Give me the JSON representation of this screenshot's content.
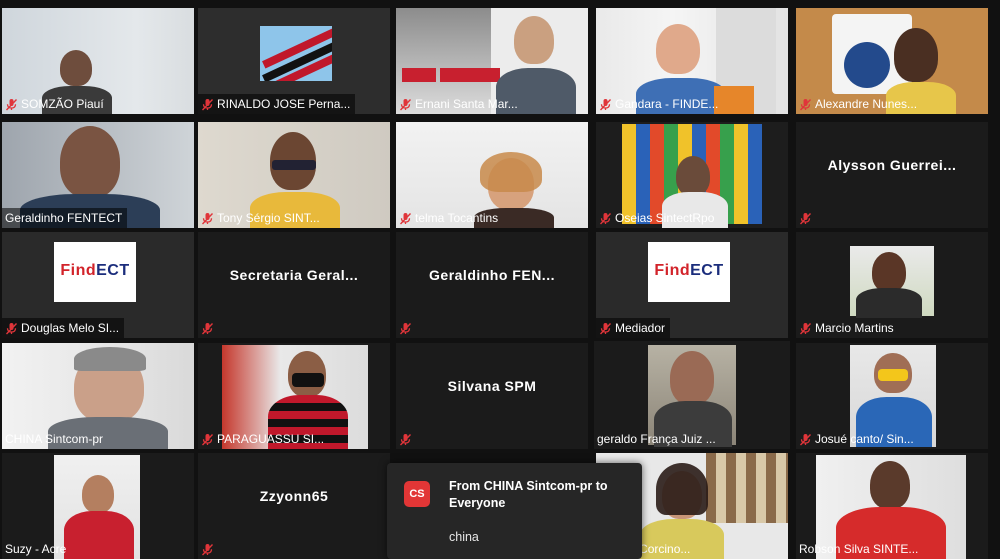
{
  "app": {
    "name": "Zoom gallery view"
  },
  "participants": [
    {
      "id": "p01",
      "name": "SOMZÃO Piauí",
      "muted": true
    },
    {
      "id": "p02",
      "name": "RINALDO JOSE Perna...",
      "muted": true
    },
    {
      "id": "p03",
      "name": "Ernani Santa Mar...",
      "muted": true
    },
    {
      "id": "p04",
      "name": "Gandara - FINDE...",
      "muted": true
    },
    {
      "id": "p05",
      "name": "Alexandre Nunes...",
      "muted": true
    },
    {
      "id": "p06",
      "name": "Geraldinho FENTECT",
      "muted": false
    },
    {
      "id": "p07",
      "name": "Tony Sérgio SINT...",
      "muted": true
    },
    {
      "id": "p08",
      "name": "telma Tocantins",
      "muted": true
    },
    {
      "id": "p09",
      "name": "Oseias SintectRpo",
      "muted": true
    },
    {
      "id": "p10",
      "name": "Alysson Guerrei...",
      "muted": true,
      "video_off": true
    },
    {
      "id": "p11",
      "name": "Douglas Melo SI...",
      "muted": true
    },
    {
      "id": "p12",
      "name": "Secretaria Geral...",
      "muted": true,
      "video_off": true
    },
    {
      "id": "p13",
      "name": "Geraldinho FEN...",
      "muted": true,
      "video_off": true
    },
    {
      "id": "p14",
      "name": "Mediador",
      "muted": true
    },
    {
      "id": "p15",
      "name": "Marcio Martins",
      "muted": true
    },
    {
      "id": "p16",
      "name": "CHINA Sintcom-pr",
      "muted": false
    },
    {
      "id": "p17",
      "name": "PARAGUASSU SI...",
      "muted": true
    },
    {
      "id": "p18",
      "name": "Silvana SPM",
      "muted": true,
      "video_off": true
    },
    {
      "id": "p19",
      "name": "geraldo França Juiz ...",
      "muted": false,
      "active_speaker": true
    },
    {
      "id": "p20",
      "name": "Josué canto/ Sin...",
      "muted": true
    },
    {
      "id": "p21",
      "name": "Suzy - Acre",
      "muted": false
    },
    {
      "id": "p22",
      "name": "Zzyonn65",
      "muted": true,
      "video_off": true
    },
    {
      "id": "p23",
      "name": "...anda Corcino...",
      "muted": false
    },
    {
      "id": "p24",
      "name": "Robson Silva SINTE...",
      "muted": true
    }
  ],
  "logos": {
    "findect_prefix": "Find",
    "findect_suffix": "ECT"
  },
  "chat_toast": {
    "avatar_initials": "CS",
    "header": "From CHINA Sintcom-pr to Everyone",
    "message": "china"
  },
  "colors": {
    "active_speaker_border": "#8fd14f",
    "muted_mic": "#e0353a",
    "chat_avatar": "#e23636",
    "tile_background": "#1b1b1b"
  }
}
